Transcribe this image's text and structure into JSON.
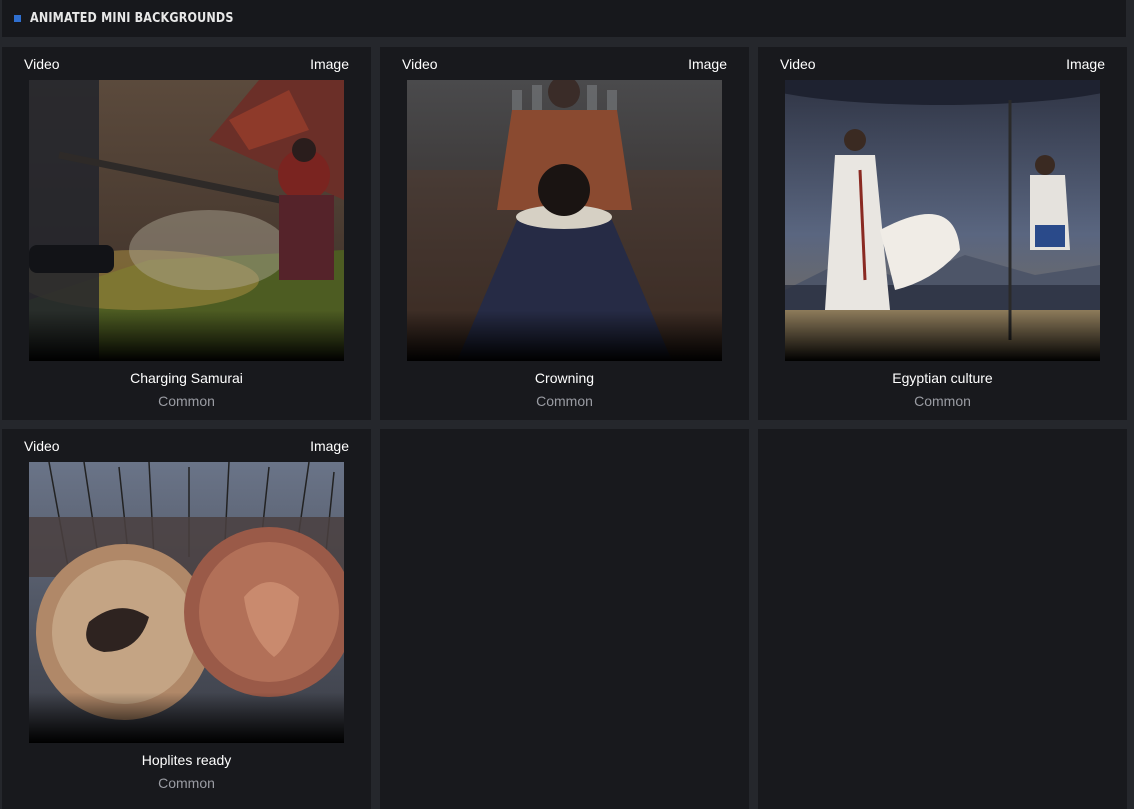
{
  "section": {
    "title": "ANIMATED MINI BACKGROUNDS",
    "accent": "#2f6fd0"
  },
  "cards": [
    {
      "video_label": "Video",
      "image_label": "Image",
      "name": "Charging Samurai",
      "rarity": "Common"
    },
    {
      "video_label": "Video",
      "image_label": "Image",
      "name": "Crowning",
      "rarity": "Common"
    },
    {
      "video_label": "Video",
      "image_label": "Image",
      "name": "Egyptian culture",
      "rarity": "Common"
    },
    {
      "video_label": "Video",
      "image_label": "Image",
      "name": "Hoplites ready",
      "rarity": "Common"
    }
  ]
}
